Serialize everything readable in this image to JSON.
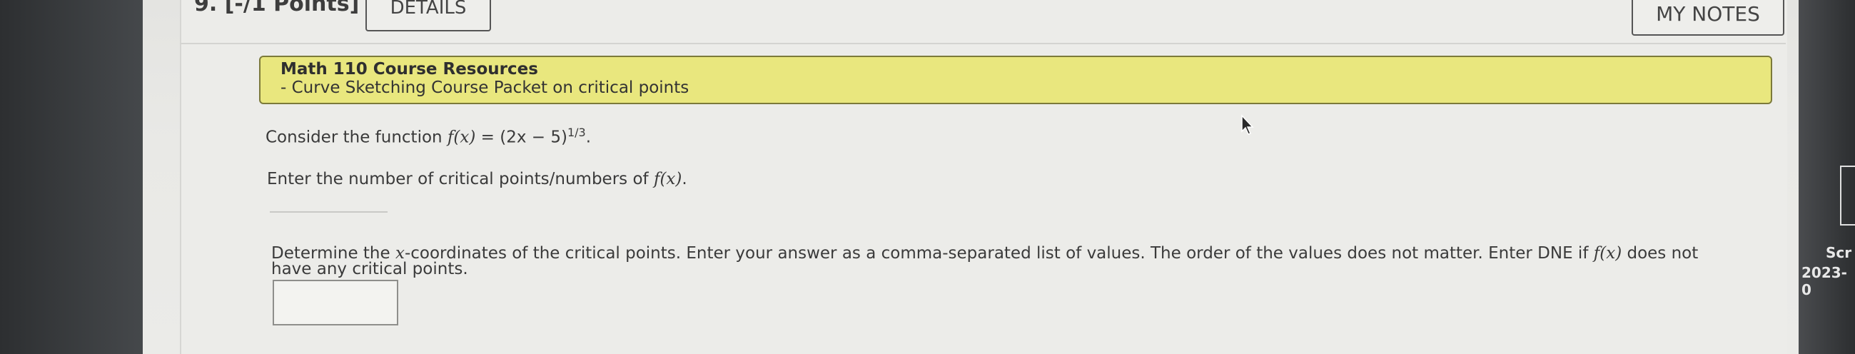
{
  "header": {
    "question_number": "9. [-/1 Points]",
    "details_label": "DETAILS",
    "notes_label": "MY NOTES"
  },
  "banner": {
    "title": "Math 110 Course Resources",
    "link": "- Curve Sketching Course Packet on critical points"
  },
  "question": {
    "prompt_prefix": "Consider the function ",
    "function_lhs": "f(x)",
    "function_eq": " = (2x − 5)",
    "exponent": "1/3",
    "period": ".",
    "part1_text": "Enter the number of critical points/numbers of ",
    "part1_fx": "f(x)",
    "part1_end": ".",
    "part2_line1_a": "Determine the ",
    "part2_line1_x": "x",
    "part2_line1_b": "-coordinates of the critical points. Enter your answer as a comma-separated list of values. The order of the values does not matter. Enter DNE if ",
    "part2_line1_fx": "f(x)",
    "part2_line1_c": " does not",
    "part2_line2": "have any critical points."
  },
  "side": {
    "text1": "Scr",
    "text2": "2023-0"
  },
  "icons": [
    "mouse-cursor-icon"
  ]
}
